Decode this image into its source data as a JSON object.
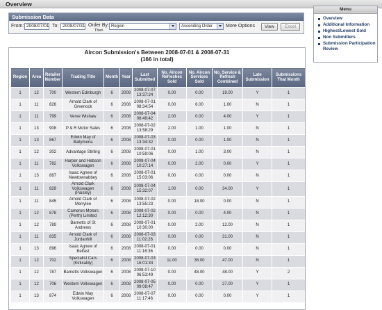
{
  "header": {
    "title": "Overview"
  },
  "filters": {
    "section_title": "Submission Data",
    "from_label": "From:",
    "from_value": "2008/07/01",
    "to_label": "To:",
    "to_value": "2008/07/31",
    "order_label": "Order By:",
    "then_label": "Then",
    "order_value": "Region",
    "direction_value": "Ascending Order",
    "more_options": "More Options",
    "view_button": "View",
    "excel_button": "Excel"
  },
  "menu": {
    "title": "Menu",
    "items": [
      "Overview",
      "Additional Information",
      "Highest/Lowest Sold",
      "Non Submitters",
      "Submission Participation Review"
    ]
  },
  "report": {
    "title_line1": "Aircon Submission's Between 2008-07-01 & 2008-07-31",
    "title_line2": "(166 in total)",
    "columns": [
      "Region",
      "Area",
      "Retailer Number",
      "Trading Title",
      "Month",
      "Year",
      "Last Submitted",
      "No. Aircon Refreshes Sold",
      "No. Aircon Services Sold",
      "No. Service & Refresh Combined",
      "Late Submission",
      "Submissions That Month"
    ],
    "rows": [
      [
        "1",
        "12",
        "700",
        "Western Edinburgh",
        "6",
        "2008",
        "2008-07-07 13:37:24",
        "0.00",
        "0.00",
        "19.00",
        "Y",
        "1"
      ],
      [
        "1",
        "11",
        "826",
        "Arnold Clark of Greenock",
        "6",
        "2008",
        "2008-07-01 08:34:54",
        "0.00",
        "6.00",
        "1.00",
        "N",
        "1"
      ],
      [
        "1",
        "11",
        "799",
        "Verve Wishaw",
        "6",
        "2008",
        "2008-07-04 08:49:42",
        "2.00",
        "0.00",
        "4.00",
        "Y",
        "1"
      ],
      [
        "1",
        "13",
        "908",
        "P & R Motor Sales",
        "6",
        "2008",
        "2008-07-02 13:58:29",
        "2.00",
        "1.00",
        "1.00",
        "N",
        "1"
      ],
      [
        "1",
        "13",
        "867",
        "Edwin May of Ballymena",
        "6",
        "2008",
        "2008-07-03 13:34:32",
        "0.00",
        "0.00",
        "1.00",
        "N",
        "1"
      ],
      [
        "1",
        "12",
        "302",
        "Advantage Stirling",
        "6",
        "2008",
        "2008-07-01 10:59:06",
        "0.00",
        "1.00",
        "3.00",
        "N",
        "1"
      ],
      [
        "1",
        "11",
        "782",
        "Harper and Hebson Volkswagen",
        "6",
        "2008",
        "2008-07-04 10:27:14",
        "0.00",
        "2.00",
        "0.00",
        "Y",
        "1"
      ],
      [
        "1",
        "13",
        "887",
        "Isaac Agnew of Newtownabbey",
        "6",
        "2008",
        "2008-07-01 15:03:06",
        "0.00",
        "0.00",
        "0.00",
        "N",
        "1"
      ],
      [
        "1",
        "11",
        "829",
        "Arnold Clark Volkswagen (Paisley)",
        "6",
        "2008",
        "2008-07-04 15:32:07",
        "1.00",
        "0.00",
        "34.00",
        "Y",
        "1"
      ],
      [
        "1",
        "11",
        "845",
        "Arnold Clark of Merrylee",
        "6",
        "2008",
        "2008-07-02 13:55:23",
        "0.00",
        "18.00",
        "0.00",
        "N",
        "1"
      ],
      [
        "1",
        "12",
        "878",
        "Cameron Motors (Perth) Limited",
        "6",
        "2008",
        "2008-07-02 12:12:30",
        "0.00",
        "0.00",
        "4.00",
        "N",
        "1"
      ],
      [
        "1",
        "12",
        "789",
        "Barnetts of St Andrews",
        "6",
        "2008",
        "2008-07-01 10:30:00",
        "0.00",
        "2.00",
        "12.00",
        "N",
        "1"
      ],
      [
        "1",
        "11",
        "835",
        "Arnold Clark of Jordanhill",
        "6",
        "2008",
        "2008-07-03 11:02:26",
        "0.00",
        "0.00",
        "31.00",
        "N",
        "1"
      ],
      [
        "1",
        "13",
        "896",
        "Isaac Agnew of Belfast",
        "6",
        "2008",
        "2008-07-01 11:16:36",
        "0.00",
        "0.00",
        "0.00",
        "N",
        "1"
      ],
      [
        "1",
        "12",
        "702",
        "Specialist Cars (Kirkcaldy)",
        "6",
        "2008",
        "2008-07-03 16:01:34",
        "11.00",
        "36.00",
        "47.00",
        "N",
        "1"
      ],
      [
        "1",
        "12",
        "787",
        "Barnetts Volkswagen",
        "6",
        "2008",
        "2008-07-10 06:53:49",
        "0.00",
        "48.00",
        "48.00",
        "Y",
        "2"
      ],
      [
        "1",
        "12",
        "706",
        "Western Volkswagen",
        "6",
        "2008",
        "2008-07-05 09:08:47",
        "0.00",
        "0.00",
        "27.00",
        "Y",
        "1"
      ],
      [
        "1",
        "13",
        "874",
        "Edwin May Volkswagen",
        "6",
        "2008",
        "2008-07-07 11:17:46",
        "0.00",
        "0.00",
        "0.00",
        "Y",
        "1"
      ]
    ]
  }
}
